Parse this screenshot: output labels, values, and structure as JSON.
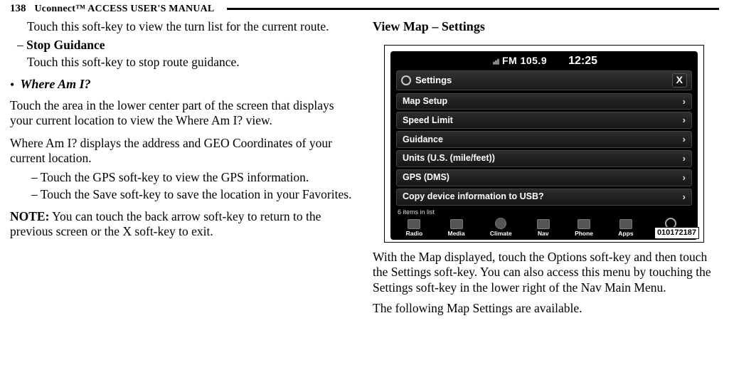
{
  "header": {
    "page_number": "138",
    "manual_title": "Uconnect™ ACCESS USER'S MANUAL"
  },
  "left": {
    "touch_turnlist": "Touch this soft-key to view the turn list for the current route.",
    "stop_guidance_h": "Stop Guidance",
    "stop_guidance_body": "Touch this soft-key to stop route guidance.",
    "where_am_i_h": "Where Am I?",
    "where_p1": "Touch the area in the lower center part of the screen that displays your current location to view the Where Am I? view.",
    "where_p2": "Where Am I? displays the address and GEO Coordinates of your current location.",
    "gps_item": "Touch the GPS soft-key to view the GPS information.",
    "save_item": "Touch the Save soft-key to save the location in your Favorites.",
    "note_label": "NOTE:",
    "note_body": " You can touch the back arrow soft-key to return to the previous screen or the X soft-key to exit."
  },
  "right": {
    "heading": "View Map – Settings",
    "p1": "With the Map displayed, touch the Options soft-key and then touch the Settings soft-key. You can also access this menu by touching the Settings soft-key in the lower right of the Nav Main Menu.",
    "p2": "The following Map Settings are available."
  },
  "figure": {
    "status": {
      "fm": "FM 105.9",
      "clock": "12:25"
    },
    "bar_label": "Settings",
    "rows": [
      "Map Setup",
      "Speed Limit",
      "Guidance",
      "Units (U.S. (mile/feet))",
      "GPS (DMS)",
      "Copy device information to USB?"
    ],
    "items_count": "6 items in list",
    "nav": [
      "Radio",
      "Media",
      "Climate",
      "Nav",
      "Phone",
      "Apps",
      "Settings"
    ],
    "fig_id": "010172187"
  }
}
